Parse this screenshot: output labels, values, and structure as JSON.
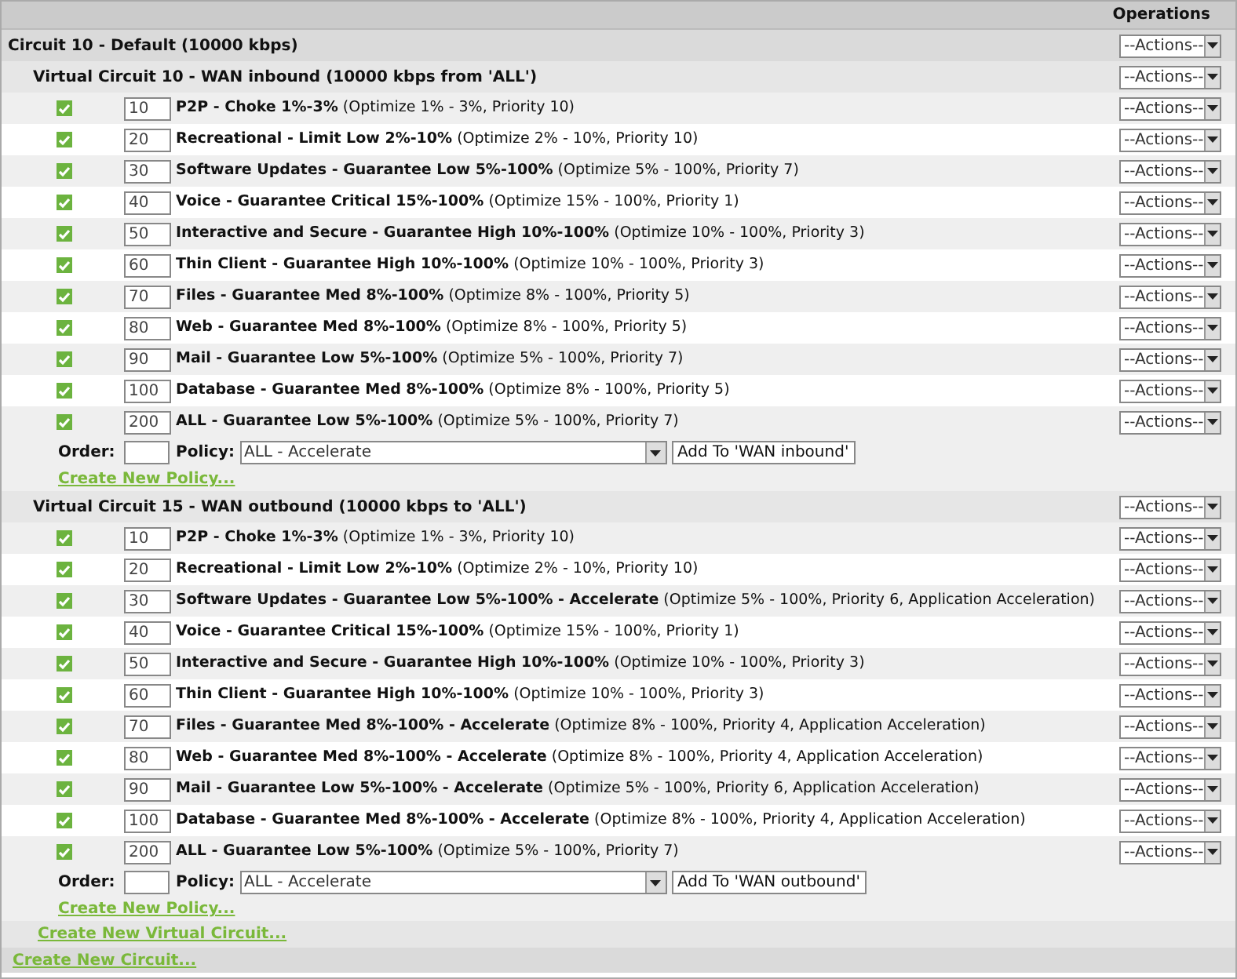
{
  "header": {
    "operations": "Operations"
  },
  "circuit": {
    "title": "Circuit 10 - Default (10000 kbps)",
    "action": "--Actions--",
    "virtual_circuits": [
      {
        "title": "Virtual Circuit 10 - WAN inbound (10000 kbps from 'ALL')",
        "action": "--Actions--",
        "policies": [
          {
            "checked": true,
            "order": "10",
            "name": "P2P - Choke 1%-3%",
            "detail": "(Optimize 1% - 3%, Priority 10)",
            "action": "--Actions--"
          },
          {
            "checked": true,
            "order": "20",
            "name": "Recreational - Limit Low 2%-10%",
            "detail": "(Optimize 2% - 10%, Priority 10)",
            "action": "--Actions--"
          },
          {
            "checked": true,
            "order": "30",
            "name": "Software Updates - Guarantee Low 5%-100%",
            "detail": "(Optimize 5% - 100%, Priority 7)",
            "action": "--Actions--"
          },
          {
            "checked": true,
            "order": "40",
            "name": "Voice - Guarantee Critical 15%-100%",
            "detail": "(Optimize 15% - 100%, Priority 1)",
            "action": "--Actions--"
          },
          {
            "checked": true,
            "order": "50",
            "name": "Interactive and Secure - Guarantee High 10%-100%",
            "detail": "(Optimize 10% - 100%, Priority 3)",
            "action": "--Actions--"
          },
          {
            "checked": true,
            "order": "60",
            "name": "Thin Client - Guarantee High 10%-100%",
            "detail": "(Optimize 10% - 100%, Priority 3)",
            "action": "--Actions--"
          },
          {
            "checked": true,
            "order": "70",
            "name": "Files - Guarantee Med 8%-100%",
            "detail": "(Optimize 8% - 100%, Priority 5)",
            "action": "--Actions--"
          },
          {
            "checked": true,
            "order": "80",
            "name": "Web - Guarantee Med 8%-100%",
            "detail": "(Optimize 8% - 100%, Priority 5)",
            "action": "--Actions--"
          },
          {
            "checked": true,
            "order": "90",
            "name": "Mail - Guarantee Low 5%-100%",
            "detail": "(Optimize 5% - 100%, Priority 7)",
            "action": "--Actions--"
          },
          {
            "checked": true,
            "order": "100",
            "name": "Database - Guarantee Med 8%-100%",
            "detail": "(Optimize 8% - 100%, Priority 5)",
            "action": "--Actions--"
          },
          {
            "checked": true,
            "order": "200",
            "name": "ALL - Guarantee Low 5%-100%",
            "detail": "(Optimize 5% - 100%, Priority 7)",
            "action": "--Actions--"
          }
        ],
        "add_form": {
          "order_label": "Order:",
          "policy_label": "Policy:",
          "policy_value": "ALL - Accelerate",
          "add_button": "Add To 'WAN inbound'"
        },
        "create_policy": "Create New Policy..."
      },
      {
        "title": "Virtual Circuit 15 - WAN outbound (10000 kbps to 'ALL')",
        "action": "--Actions--",
        "policies": [
          {
            "checked": true,
            "order": "10",
            "name": "P2P - Choke 1%-3%",
            "detail": "(Optimize 1% - 3%, Priority 10)",
            "action": "--Actions--"
          },
          {
            "checked": true,
            "order": "20",
            "name": "Recreational - Limit Low 2%-10%",
            "detail": "(Optimize 2% - 10%, Priority 10)",
            "action": "--Actions--"
          },
          {
            "checked": true,
            "order": "30",
            "name": "Software Updates - Guarantee Low 5%-100% - Accelerate",
            "detail": "(Optimize 5% - 100%, Priority 6, Application Acceleration)",
            "action": "--Actions--"
          },
          {
            "checked": true,
            "order": "40",
            "name": "Voice - Guarantee Critical 15%-100%",
            "detail": "(Optimize 15% - 100%, Priority 1)",
            "action": "--Actions--"
          },
          {
            "checked": true,
            "order": "50",
            "name": "Interactive and Secure - Guarantee High 10%-100%",
            "detail": "(Optimize 10% - 100%, Priority 3)",
            "action": "--Actions--"
          },
          {
            "checked": true,
            "order": "60",
            "name": "Thin Client - Guarantee High 10%-100%",
            "detail": "(Optimize 10% - 100%, Priority 3)",
            "action": "--Actions--"
          },
          {
            "checked": true,
            "order": "70",
            "name": "Files - Guarantee Med 8%-100% - Accelerate",
            "detail": "(Optimize 8% - 100%, Priority 4, Application Acceleration)",
            "action": "--Actions--"
          },
          {
            "checked": true,
            "order": "80",
            "name": "Web - Guarantee Med 8%-100% - Accelerate",
            "detail": "(Optimize 8% - 100%, Priority 4, Application Acceleration)",
            "action": "--Actions--"
          },
          {
            "checked": true,
            "order": "90",
            "name": "Mail - Guarantee Low 5%-100% - Accelerate",
            "detail": "(Optimize 5% - 100%, Priority 6, Application Acceleration)",
            "action": "--Actions--"
          },
          {
            "checked": true,
            "order": "100",
            "name": "Database - Guarantee Med 8%-100% - Accelerate",
            "detail": "(Optimize 8% - 100%, Priority 4, Application Acceleration)",
            "action": "--Actions--"
          },
          {
            "checked": true,
            "order": "200",
            "name": "ALL - Guarantee Low 5%-100%",
            "detail": "(Optimize 5% - 100%, Priority 7)",
            "action": "--Actions--"
          }
        ],
        "add_form": {
          "order_label": "Order:",
          "policy_label": "Policy:",
          "policy_value": "ALL - Accelerate",
          "add_button": "Add To 'WAN outbound'"
        },
        "create_policy": "Create New Policy..."
      }
    ],
    "create_virtual_circuit": "Create New Virtual Circuit..."
  },
  "create_circuit": "Create New Circuit..."
}
